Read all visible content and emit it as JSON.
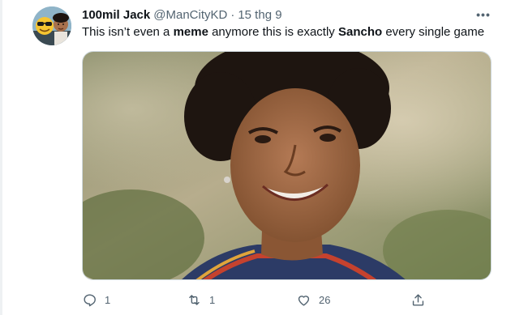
{
  "tweet": {
    "author_name": "100mil Jack",
    "handle": "@ManCityKD",
    "separator": "·",
    "time": "15 thg 9",
    "text_before": "This isn’t even a ",
    "text_bold1": "meme",
    "text_middle": " anymore this is exactly ",
    "text_bold2": "Sancho",
    "text_after": " every single game",
    "more_label": "•••",
    "media_icon": "photo-of-smiling-woman"
  },
  "actions": {
    "reply_count": "1",
    "retweet_count": "1",
    "like_count": "26",
    "reply_icon": "reply-icon",
    "retweet_icon": "retweet-icon",
    "like_icon": "heart-icon",
    "share_icon": "share-icon"
  },
  "colors": {
    "text_primary": "#0f1419",
    "text_secondary": "#536471",
    "border": "#cfd9de"
  }
}
